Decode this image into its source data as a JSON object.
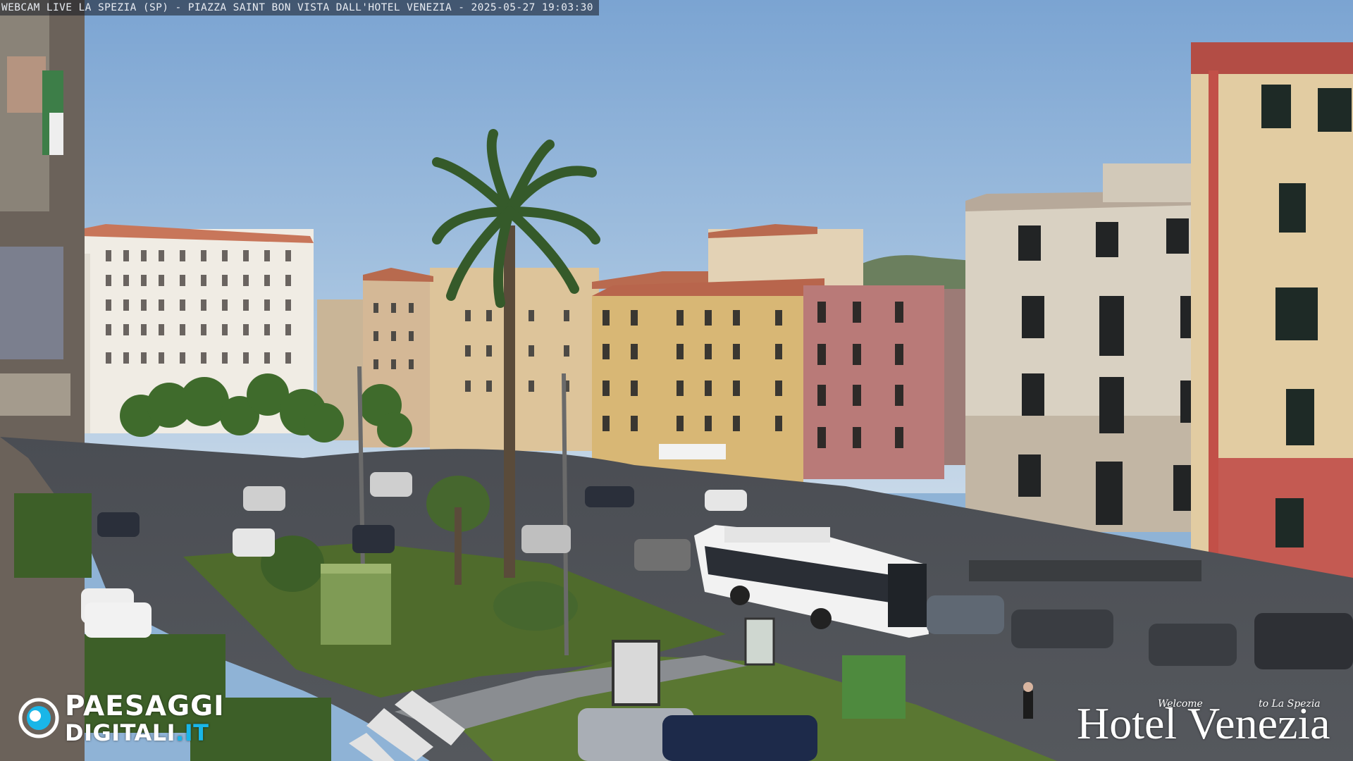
{
  "caption": "WEBCAM LIVE LA SPEZIA (SP) - PIAZZA SAINT BON VISTA DALL'HOTEL VENEZIA - 2025-05-27 19:03:30",
  "logo_left": {
    "line1": "PAESAGGI",
    "line2_main": "DIGITALI",
    "line2_suffix": ".IT",
    "accent_color": "#19b6e8"
  },
  "logo_right": {
    "welcome": "Welcome",
    "to": "to La Spezia",
    "name": "Hotel Venezia"
  },
  "colors": {
    "sky": "#8fb3d6",
    "road": "#5a5d62",
    "grass": "#4f6b2c",
    "building_yellow": "#d8b775",
    "building_pink": "#b97a78",
    "building_cream": "#d9d1c2",
    "building_white": "#f0ece4",
    "bus": "#f2f2f2"
  }
}
